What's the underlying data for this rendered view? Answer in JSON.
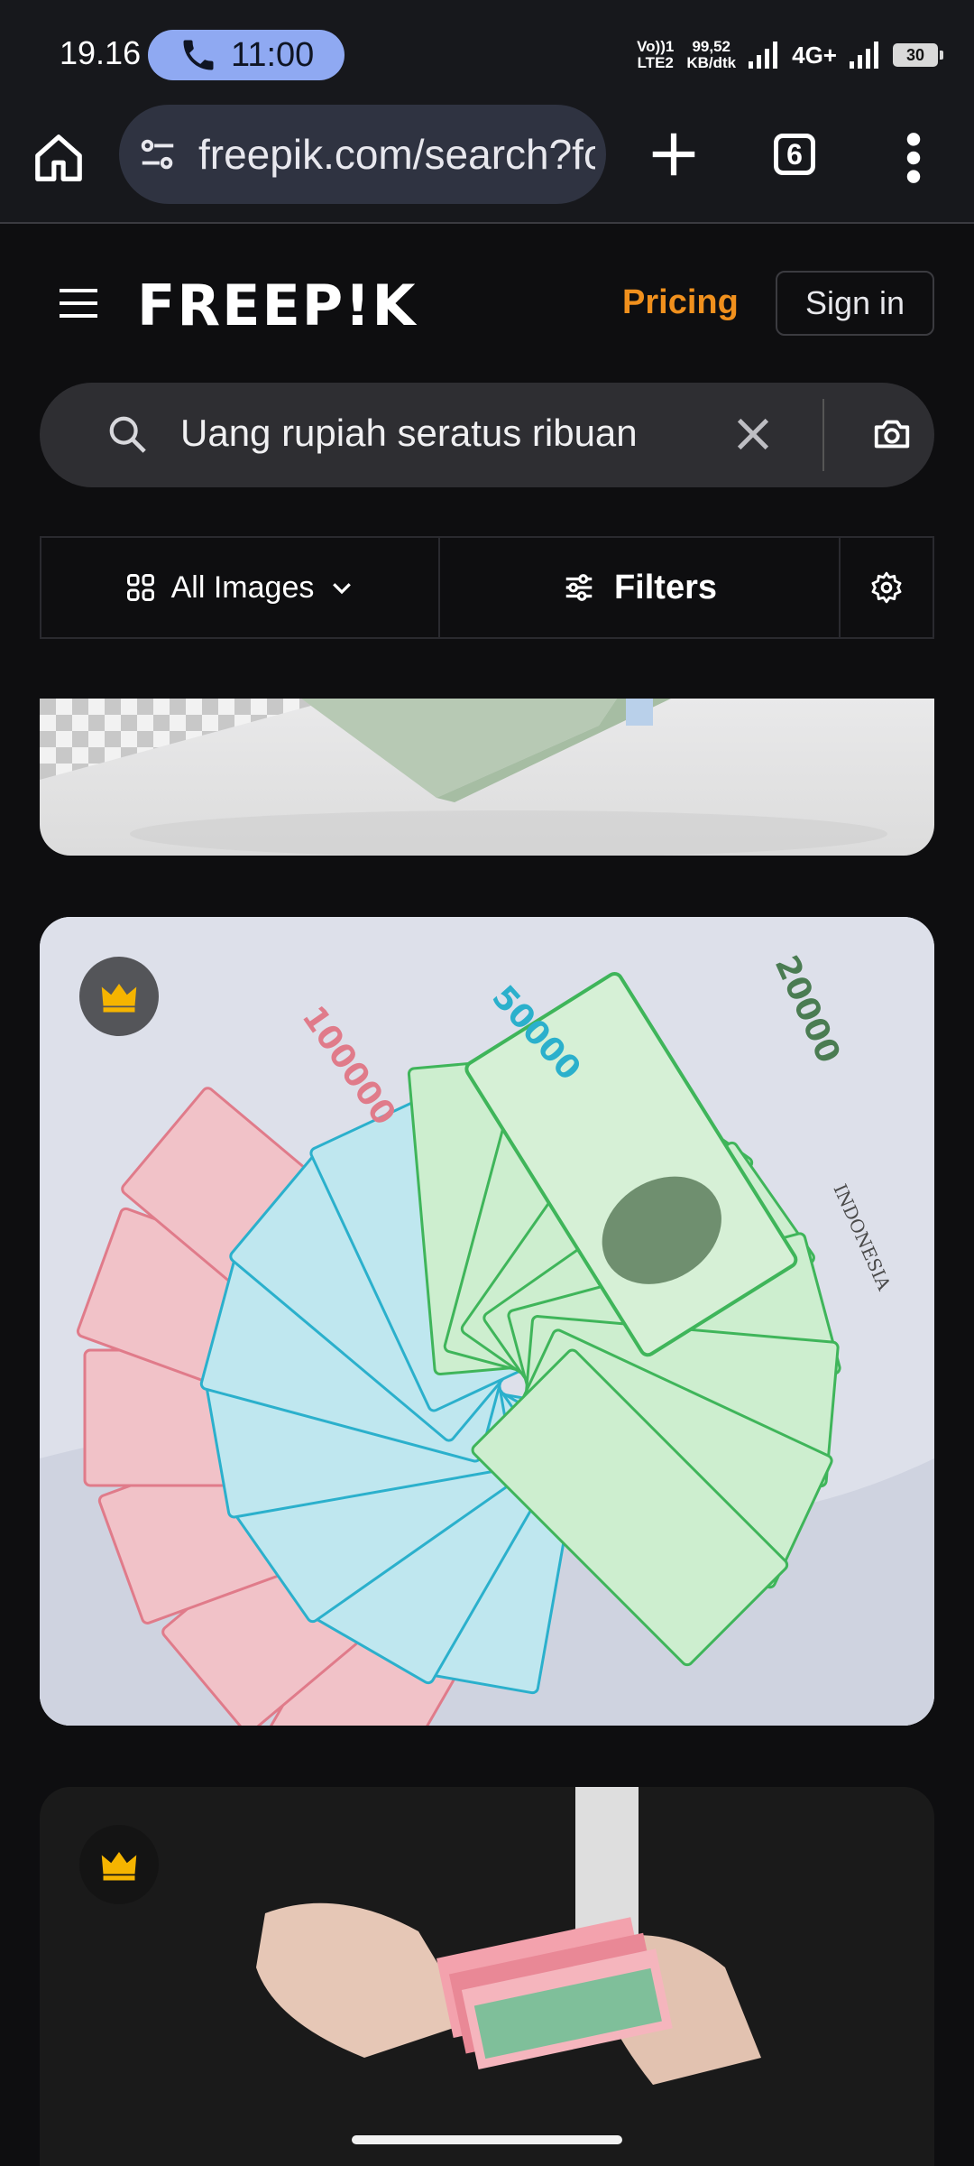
{
  "status_bar": {
    "time": "19.16",
    "call_timer": "11:00",
    "volte_line1": "Vo))1",
    "volte_line2": "LTE2",
    "speed_value": "99,52",
    "speed_unit": "KB/dtk",
    "network": "4G+",
    "battery": "30"
  },
  "browser": {
    "url": "freepik.com/search?format=search",
    "tab_count": "6"
  },
  "site": {
    "logo": "FREEP!K",
    "pricing_label": "Pricing",
    "signin_label": "Sign in"
  },
  "search": {
    "query": "Uang rupiah seratus ribuan"
  },
  "filters": {
    "type_label": "All Images",
    "filters_label": "Filters"
  },
  "results": [
    {
      "premium": false
    },
    {
      "premium": true,
      "banknote_values": [
        "100000",
        "50000",
        "20000"
      ],
      "banknote_country": "INDONESIA"
    },
    {
      "premium": true
    }
  ],
  "colors": {
    "accent_pricing": "#f0901d",
    "crown": "#f5b400",
    "background": "#0e0e10"
  }
}
